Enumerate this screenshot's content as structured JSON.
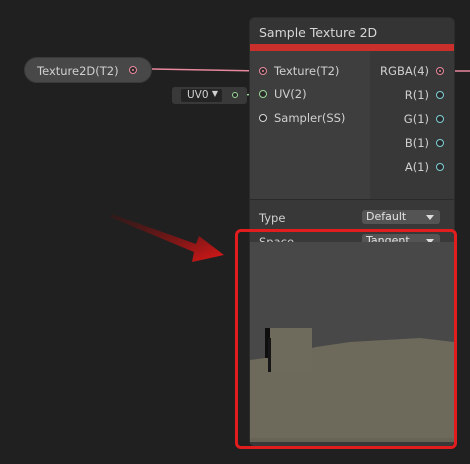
{
  "property_node": {
    "label": "Texture2D(T2)"
  },
  "uv_node": {
    "value": "UV0"
  },
  "sample_node": {
    "title": "Sample Texture 2D",
    "inputs": [
      {
        "label": "Texture(T2)",
        "port": "pink"
      },
      {
        "label": "UV(2)",
        "port": "green"
      },
      {
        "label": "Sampler(SS)",
        "port": "white"
      }
    ],
    "outputs": [
      {
        "label": "RGBA(4)",
        "port": "pink"
      },
      {
        "label": "R(1)",
        "port": "cyan"
      },
      {
        "label": "G(1)",
        "port": "cyan"
      },
      {
        "label": "B(1)",
        "port": "cyan"
      },
      {
        "label": "A(1)",
        "port": "cyan"
      }
    ],
    "settings": {
      "type_label": "Type",
      "type_value": "Default",
      "space_label": "Space",
      "space_value": "Tangent"
    }
  },
  "colors": {
    "accent_bar": "#c9302c",
    "highlight": "#e11d1d",
    "texture_wire": "#e8889d",
    "uv_wire": "#9ad99a"
  }
}
